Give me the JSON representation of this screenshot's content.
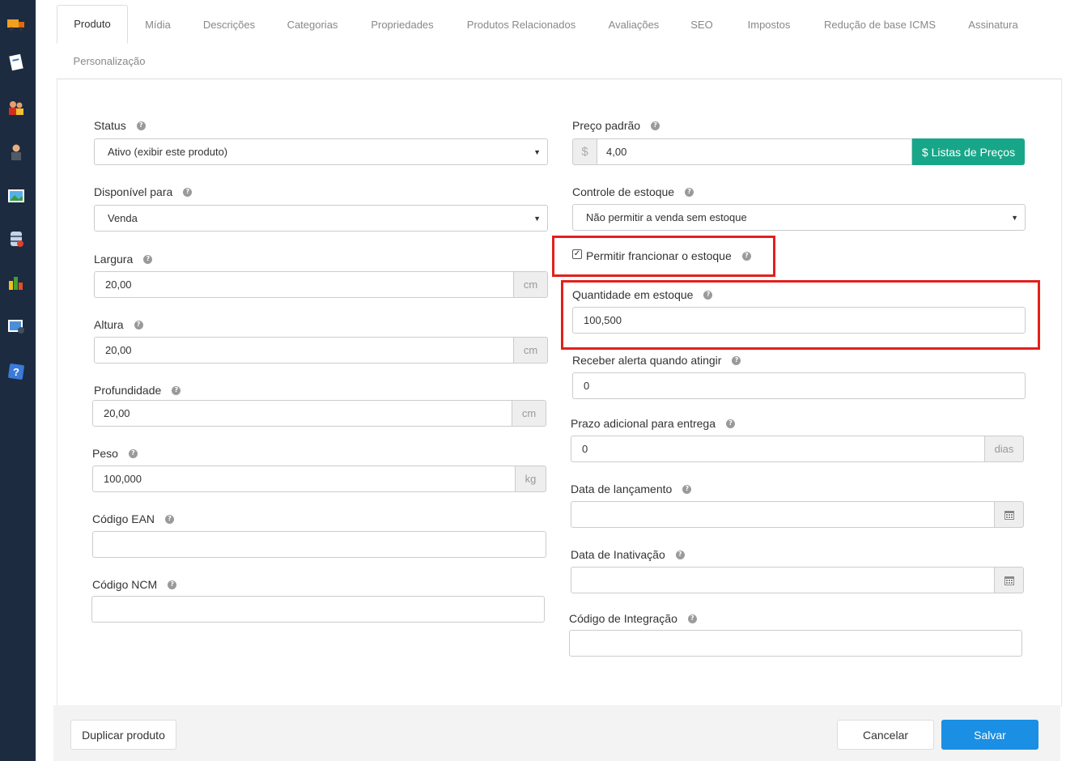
{
  "sidebar": {
    "icons": [
      "truck-icon",
      "note-icon",
      "users-icon",
      "user-icon",
      "image-icon",
      "database-icon",
      "bar-chart-icon",
      "photo-settings-icon",
      "help-icon"
    ]
  },
  "tabs": [
    {
      "label": "Produto",
      "active": true
    },
    {
      "label": "Mídia"
    },
    {
      "label": "Descrições"
    },
    {
      "label": "Categorias"
    },
    {
      "label": "Propriedades"
    },
    {
      "label": "Produtos Relacionados"
    },
    {
      "label": "Avaliações"
    },
    {
      "label": "SEO"
    },
    {
      "label": "Impostos"
    },
    {
      "label": "Redução de base ICMS"
    },
    {
      "label": "Assinatura"
    },
    {
      "label": "Personalização"
    }
  ],
  "left": {
    "status": {
      "label": "Status",
      "value": "Ativo (exibir este produto)"
    },
    "disponivel": {
      "label": "Disponível para",
      "value": "Venda"
    },
    "largura": {
      "label": "Largura",
      "value": "20,00",
      "unit": "cm"
    },
    "altura": {
      "label": "Altura",
      "value": "20,00",
      "unit": "cm"
    },
    "profundidade": {
      "label": "Profundidade",
      "value": "20,00",
      "unit": "cm"
    },
    "peso": {
      "label": "Peso",
      "value": "100,000",
      "unit": "kg"
    },
    "ean": {
      "label": "Código EAN",
      "value": ""
    },
    "ncm": {
      "label": "Código NCM",
      "value": ""
    }
  },
  "right": {
    "preco": {
      "label": "Preço padrão",
      "currency": "$",
      "value": "4,00",
      "button": "$ Listas de Preços"
    },
    "controle": {
      "label": "Controle de estoque",
      "value": "Não permitir a venda sem estoque"
    },
    "fracionar": {
      "label": "Permitir francionar o estoque",
      "checked": true
    },
    "quantidade": {
      "label": "Quantidade em estoque",
      "value": "100,500"
    },
    "alerta": {
      "label": "Receber alerta quando atingir",
      "value": "0"
    },
    "prazo": {
      "label": "Prazo adicional para entrega",
      "value": "0",
      "unit": "dias"
    },
    "lancamento": {
      "label": "Data de lançamento",
      "value": ""
    },
    "inativacao": {
      "label": "Data de Inativação",
      "value": ""
    },
    "integracao": {
      "label": "Código de Integração",
      "value": ""
    }
  },
  "footer": {
    "duplicate": "Duplicar produto",
    "cancel": "Cancelar",
    "save": "Salvar"
  },
  "colors": {
    "sidebar": "#1c2b40",
    "accent_green": "#18a689",
    "primary_blue": "#1a8fe3",
    "highlight_red": "#e2211c"
  }
}
